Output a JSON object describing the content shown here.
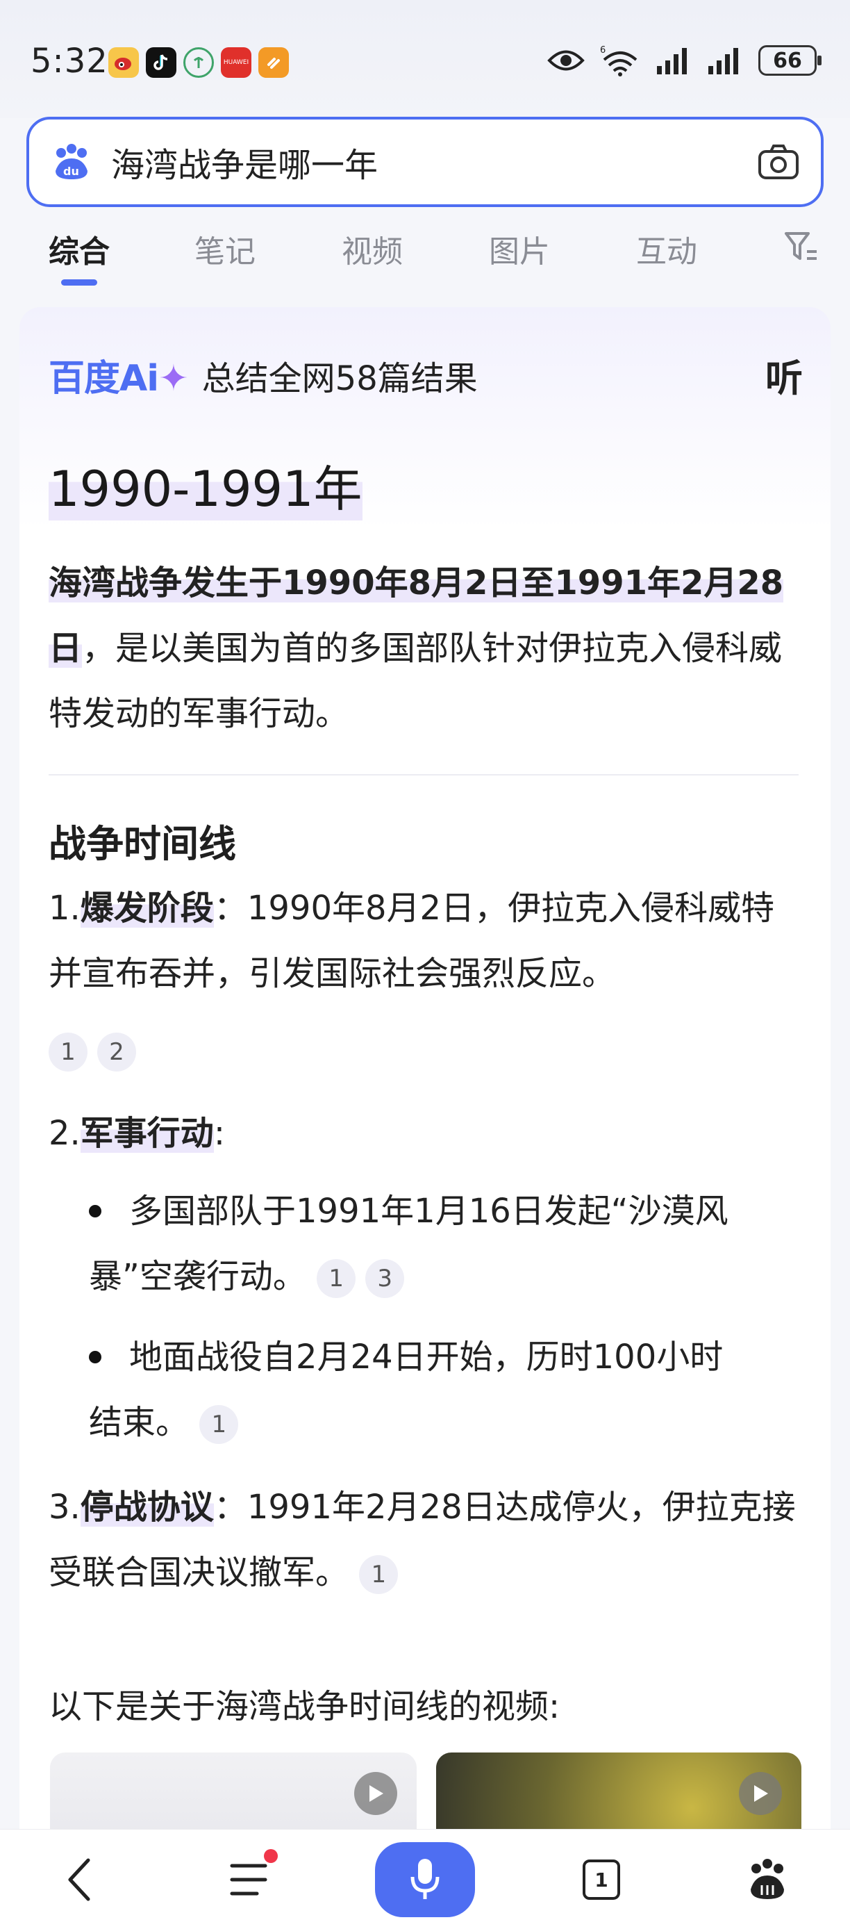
{
  "status": {
    "time": "5:32",
    "battery": "66",
    "app_icons": [
      "weibo-icon",
      "tiktok-icon",
      "green-app-icon",
      "huawei-icon",
      "orange-app-icon"
    ],
    "huawei_label": "HUAWEI"
  },
  "search": {
    "query": "海湾战争是哪一年"
  },
  "tabs": [
    "综合",
    "笔记",
    "视频",
    "图片",
    "互动"
  ],
  "ai": {
    "logo_text": "百度Ai",
    "summary": "总结全网58篇结果",
    "listen": "听",
    "answer_title": "1990-1991年",
    "answer_highlight": "海湾战争发生于1990年8月2日至1991年2月28日",
    "answer_rest": "，是以美国为首的多国部队针对伊拉克入侵科威特发动的军事行动。",
    "timeline_title": "战争时间线",
    "items": [
      {
        "num": "1.",
        "label": "爆发阶段",
        "sep": "：",
        "text": "1990年8月2日，伊拉克入侵科威特并宣布吞并，引发国际社会强烈反应。"
      },
      {
        "num": "2.",
        "label": "军事行动",
        "sep": ":"
      },
      {
        "num": "3.",
        "label": "停战协议",
        "sep": "：",
        "text": "1991年2月28日达成停火，伊拉克接受联合国决议撤军。"
      }
    ],
    "bullets": [
      {
        "line1": "多国部队于1991年1月16日发起“沙漠风",
        "line2": "暴”空袭行动。"
      },
      {
        "line1": "地面战役自2月24日开始，历时100小时",
        "line2": "结束。"
      }
    ],
    "cites": {
      "item1": [
        "1",
        "2"
      ],
      "bullet1": [
        "1",
        "3"
      ],
      "bullet2": [
        "1"
      ],
      "item3": [
        "1"
      ]
    },
    "video_intro": "以下是关于海湾战争时间线的视频:"
  },
  "bottom": {
    "tab_count": "1"
  },
  "colors": {
    "accent": "#4e6ef2",
    "highlight": "#ece7fb",
    "notification": "#f0364a"
  }
}
